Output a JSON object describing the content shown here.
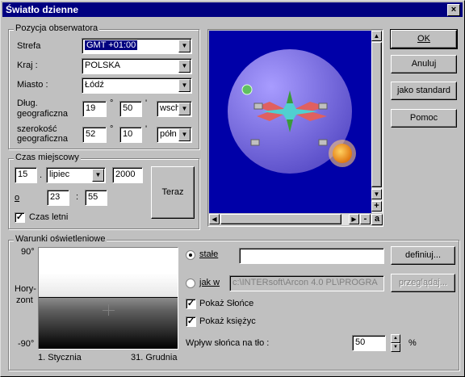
{
  "window": {
    "title": "Światło dzienne",
    "close": "×"
  },
  "observer": {
    "legend": "Pozycja obserwatora",
    "zone_label": "Strefa",
    "zone_value": "GMT +01:00",
    "country_label": "Kraj :",
    "country_value": "POLSKA",
    "city_label": "Miasto :",
    "city_value": "Łódź",
    "lon_label_1": "Dług.",
    "lon_label_2": "geograficzna",
    "lon_deg": "19",
    "lon_min": "50",
    "lon_dir": "wsch",
    "lat_label_1": "szerokość",
    "lat_label_2": "geograficzna",
    "lat_deg": "52",
    "lat_min": "10",
    "lat_dir": "półn",
    "deg_mark": "°",
    "min_mark": "'"
  },
  "local_time": {
    "legend": "Czas miejscowy",
    "day": "15",
    "dot": ".",
    "month": "lipiec",
    "year": "2000",
    "hour_label": "o",
    "hour": "23",
    "colon": ":",
    "minute": "55",
    "now_button": "Teraz",
    "dst_label": "Czas letni",
    "dst_checked": true
  },
  "buttons": {
    "ok": "OK",
    "cancel": "Anuluj",
    "default": "jako standard",
    "help": "Pomoc"
  },
  "scroll": {
    "plus": "+",
    "minus": "-",
    "a": "a"
  },
  "lighting": {
    "legend": "Warunki oświetleniowe",
    "y_top": "90°",
    "y_mid_1": "Hory-",
    "y_mid_2": "zont",
    "y_bottom": "-90°",
    "x_left": "1. Stycznia",
    "x_right": "31. Grudnia",
    "fixed_label": "stałe",
    "fixed_value": "",
    "define_button": "definiuj...",
    "as_in_label": "jak w",
    "as_in_value": "c:\\INTERsoft\\Arcon 4.0 PL\\PROGRA",
    "browse_button": "przeglądaj...",
    "show_sun": "Pokaż Słońce",
    "show_moon": "Pokaż księżyc",
    "sun_effect_label": "Wpływ słońca na tło :",
    "sun_effect_value": "50",
    "percent": "%"
  },
  "colors": {
    "title_bg": "#000080",
    "globe": "#7b6fe0",
    "sky_bg": "#0000a8",
    "sun": "#f0a020"
  }
}
